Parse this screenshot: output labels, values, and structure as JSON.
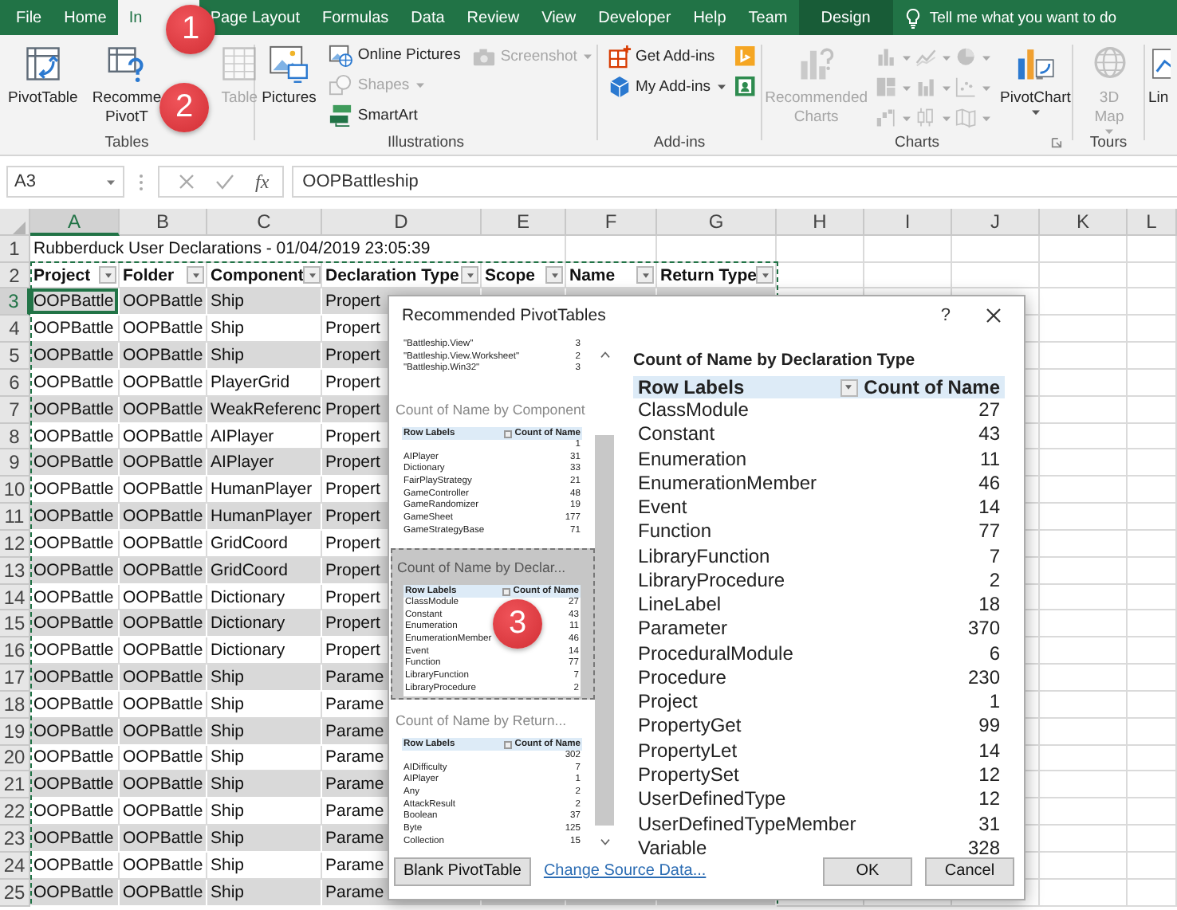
{
  "tabs": [
    {
      "label": "File",
      "selected": false,
      "contextual": false
    },
    {
      "label": "Home",
      "selected": false,
      "contextual": false
    },
    {
      "label": "In",
      "selected": true,
      "contextual": false
    },
    {
      "label": "Page Layout",
      "selected": false,
      "contextual": false
    },
    {
      "label": "Formulas",
      "selected": false,
      "contextual": false
    },
    {
      "label": "Data",
      "selected": false,
      "contextual": false
    },
    {
      "label": "Review",
      "selected": false,
      "contextual": false
    },
    {
      "label": "View",
      "selected": false,
      "contextual": false
    },
    {
      "label": "Developer",
      "selected": false,
      "contextual": false
    },
    {
      "label": "Help",
      "selected": false,
      "contextual": false
    },
    {
      "label": "Team",
      "selected": false,
      "contextual": false
    },
    {
      "label": "Design",
      "selected": false,
      "contextual": true
    }
  ],
  "tell_me": {
    "placeholder": "Tell me what you want to do"
  },
  "ribbon": {
    "groups": [
      {
        "label": "Tables",
        "columns": [
          [
            {
              "kind": "large",
              "lines": [
                "PivotTable"
              ],
              "disabled": false,
              "dropdown": false
            }
          ],
          [
            {
              "kind": "large",
              "lines": [
                "Recomme",
                "PivotT"
              ],
              "disabled": false,
              "dropdown": false
            }
          ],
          [
            {
              "kind": "large",
              "lines": [
                "Table"
              ],
              "disabled": true,
              "dropdown": false
            }
          ]
        ]
      },
      {
        "label": "Illustrations",
        "columns": [
          [
            {
              "kind": "large",
              "lines": [
                "Pictures"
              ],
              "disabled": false,
              "dropdown": false
            }
          ],
          [
            {
              "kind": "small",
              "label": "Online Pictures",
              "disabled": false,
              "dropdown": false
            },
            {
              "kind": "small",
              "label": "Shapes",
              "disabled": true,
              "dropdown": true
            },
            {
              "kind": "small",
              "label": "SmartArt",
              "disabled": false,
              "dropdown": false
            }
          ],
          [
            {
              "kind": "small",
              "label": "Screenshot",
              "disabled": true,
              "dropdown": true
            }
          ]
        ]
      },
      {
        "label": "Add-ins",
        "columns": [
          [
            {
              "kind": "small",
              "label": "Get Add-ins",
              "disabled": false,
              "dropdown": false
            },
            {
              "kind": "small",
              "label": "My Add-ins",
              "disabled": false,
              "dropdown": true
            }
          ],
          [
            {
              "kind": "icon",
              "disabled": false,
              "dropdown": false
            },
            {
              "kind": "icon",
              "disabled": false,
              "dropdown": false
            }
          ]
        ]
      },
      {
        "label": "Charts",
        "launcher": true,
        "columns": [
          [
            {
              "kind": "large",
              "lines": [
                "Recommended",
                "Charts"
              ],
              "disabled": true,
              "dropdown": false
            }
          ],
          [
            {
              "kind": "icon",
              "disabled": true,
              "dropdown": true
            },
            {
              "kind": "icon",
              "disabled": true,
              "dropdown": true
            },
            {
              "kind": "icon",
              "disabled": true,
              "dropdown": true
            }
          ],
          [
            {
              "kind": "icon",
              "disabled": true,
              "dropdown": true
            },
            {
              "kind": "icon",
              "disabled": true,
              "dropdown": true
            },
            {
              "kind": "icon",
              "disabled": true,
              "dropdown": true
            }
          ],
          [
            {
              "kind": "icon",
              "disabled": true,
              "dropdown": true
            },
            {
              "kind": "icon",
              "disabled": true,
              "dropdown": true
            },
            {
              "kind": "icon",
              "disabled": true,
              "dropdown": true
            }
          ],
          [
            {
              "kind": "large",
              "lines": [
                "PivotChart"
              ],
              "disabled": false,
              "dropdown": true
            }
          ]
        ]
      },
      {
        "label": "Tours",
        "columns": [
          [
            {
              "kind": "large",
              "lines": [
                "3D",
                "Map"
              ],
              "disabled": true,
              "dropdown": true
            }
          ]
        ]
      },
      {
        "columns": [
          [
            {
              "kind": "large",
              "lines": [
                "Lin"
              ],
              "disabled": false,
              "dropdown": false
            }
          ]
        ]
      }
    ]
  },
  "formula_bar": {
    "name_box": "A3",
    "function_label": "fx",
    "formula": "OOPBattleship"
  },
  "sheet": {
    "marquee": true,
    "columns": [
      {
        "label": "A",
        "selected": true
      },
      {
        "label": "B",
        "selected": false
      },
      {
        "label": "C",
        "selected": false
      },
      {
        "label": "D",
        "selected": false
      },
      {
        "label": "E",
        "selected": false
      },
      {
        "label": "F",
        "selected": false
      },
      {
        "label": "G",
        "selected": false
      },
      {
        "label": "H",
        "selected": false
      },
      {
        "label": "I",
        "selected": false
      },
      {
        "label": "J",
        "selected": false
      },
      {
        "label": "K",
        "selected": false
      },
      {
        "label": "L",
        "selected": false
      }
    ],
    "rows": [
      {
        "number": "1",
        "kind": "title",
        "selected": false,
        "banded": false,
        "cells": [
          "Rubberduck User Declarations - 01/04/2019 23:05:39"
        ]
      },
      {
        "number": "2",
        "kind": "header",
        "selected": false,
        "banded": false,
        "cells": [
          "Project",
          "Folder",
          "Component",
          "Declaration Type",
          "Scope",
          "Name",
          "Return Type"
        ]
      },
      {
        "number": "3",
        "kind": "data",
        "selected": true,
        "banded": true,
        "cells": [
          "OOPBattle",
          "OOPBattle",
          "Ship",
          "Propert"
        ]
      },
      {
        "number": "4",
        "kind": "data",
        "selected": false,
        "banded": false,
        "cells": [
          "OOPBattle",
          "OOPBattle",
          "Ship",
          "Propert"
        ]
      },
      {
        "number": "5",
        "kind": "data",
        "selected": false,
        "banded": true,
        "cells": [
          "OOPBattle",
          "OOPBattle",
          "Ship",
          "Propert"
        ]
      },
      {
        "number": "6",
        "kind": "data",
        "selected": false,
        "banded": false,
        "cells": [
          "OOPBattle",
          "OOPBattle",
          "PlayerGrid",
          "Propert"
        ]
      },
      {
        "number": "7",
        "kind": "data",
        "selected": false,
        "banded": true,
        "cells": [
          "OOPBattle",
          "OOPBattle",
          "WeakReferenc",
          "Propert"
        ]
      },
      {
        "number": "8",
        "kind": "data",
        "selected": false,
        "banded": false,
        "cells": [
          "OOPBattle",
          "OOPBattle",
          "AIPlayer",
          "Propert"
        ]
      },
      {
        "number": "9",
        "kind": "data",
        "selected": false,
        "banded": true,
        "cells": [
          "OOPBattle",
          "OOPBattle",
          "AIPlayer",
          "Propert"
        ]
      },
      {
        "number": "10",
        "kind": "data",
        "selected": false,
        "banded": false,
        "cells": [
          "OOPBattle",
          "OOPBattle",
          "HumanPlayer",
          "Propert"
        ]
      },
      {
        "number": "11",
        "kind": "data",
        "selected": false,
        "banded": true,
        "cells": [
          "OOPBattle",
          "OOPBattle",
          "HumanPlayer",
          "Propert"
        ]
      },
      {
        "number": "12",
        "kind": "data",
        "selected": false,
        "banded": false,
        "cells": [
          "OOPBattle",
          "OOPBattle",
          "GridCoord",
          "Propert"
        ]
      },
      {
        "number": "13",
        "kind": "data",
        "selected": false,
        "banded": true,
        "cells": [
          "OOPBattle",
          "OOPBattle",
          "GridCoord",
          "Propert"
        ]
      },
      {
        "number": "14",
        "kind": "data",
        "selected": false,
        "banded": false,
        "cells": [
          "OOPBattle",
          "OOPBattle",
          "Dictionary",
          "Propert"
        ]
      },
      {
        "number": "15",
        "kind": "data",
        "selected": false,
        "banded": true,
        "cells": [
          "OOPBattle",
          "OOPBattle",
          "Dictionary",
          "Propert"
        ]
      },
      {
        "number": "16",
        "kind": "data",
        "selected": false,
        "banded": false,
        "cells": [
          "OOPBattle",
          "OOPBattle",
          "Dictionary",
          "Propert"
        ]
      },
      {
        "number": "17",
        "kind": "data",
        "selected": false,
        "banded": true,
        "cells": [
          "OOPBattle",
          "OOPBattle",
          "Ship",
          "Parame"
        ]
      },
      {
        "number": "18",
        "kind": "data",
        "selected": false,
        "banded": false,
        "cells": [
          "OOPBattle",
          "OOPBattle",
          "Ship",
          "Parame"
        ]
      },
      {
        "number": "19",
        "kind": "data",
        "selected": false,
        "banded": true,
        "cells": [
          "OOPBattle",
          "OOPBattle",
          "Ship",
          "Parame"
        ]
      },
      {
        "number": "20",
        "kind": "data",
        "selected": false,
        "banded": false,
        "cells": [
          "OOPBattle",
          "OOPBattle",
          "Ship",
          "Parame"
        ]
      },
      {
        "number": "21",
        "kind": "data",
        "selected": false,
        "banded": true,
        "cells": [
          "OOPBattle",
          "OOPBattle",
          "Ship",
          "Parame"
        ]
      },
      {
        "number": "22",
        "kind": "data",
        "selected": false,
        "banded": false,
        "cells": [
          "OOPBattle",
          "OOPBattle",
          "Ship",
          "Parame"
        ]
      },
      {
        "number": "23",
        "kind": "data",
        "selected": false,
        "banded": true,
        "cells": [
          "OOPBattle",
          "OOPBattle",
          "Ship",
          "Parame"
        ]
      },
      {
        "number": "24",
        "kind": "data",
        "selected": false,
        "banded": false,
        "cells": [
          "OOPBattle",
          "OOPBattle",
          "Ship",
          "Parame"
        ]
      },
      {
        "number": "25",
        "kind": "data",
        "selected": false,
        "banded": true,
        "cells": [
          "OOPBattle",
          "OOPBattle",
          "Ship",
          "Parame"
        ]
      }
    ]
  },
  "dialog": {
    "title": "Recommended PivotTables",
    "help_label": "?",
    "cards": [
      {
        "selected": false,
        "rows": [
          {
            "label": "\"Battleship.View\"",
            "count": "3"
          },
          {
            "label": "\"Battleship.View.Worksheet\"",
            "count": "2"
          },
          {
            "label": "\"Battleship.Win32\"",
            "count": "3"
          }
        ]
      },
      {
        "title": "Count of Name by Component",
        "selected": false,
        "columns": [
          "Row Labels",
          "Count of Name"
        ],
        "rows": [
          {
            "count": "1"
          },
          {
            "label": "AIPlayer",
            "count": "31"
          },
          {
            "label": "Dictionary",
            "count": "33"
          },
          {
            "label": "FairPlayStrategy",
            "count": "21"
          },
          {
            "label": "GameController",
            "count": "48"
          },
          {
            "label": "GameRandomizer",
            "count": "19"
          },
          {
            "label": "GameSheet",
            "count": "177"
          },
          {
            "label": "GameStrategyBase",
            "count": "71"
          }
        ]
      },
      {
        "title": "Count of Name by Declar...",
        "selected": true,
        "columns": [
          "Row Labels",
          "Count of Name"
        ],
        "rows": [
          {
            "label": "ClassModule",
            "count": "27"
          },
          {
            "label": "Constant",
            "count": "43"
          },
          {
            "label": "Enumeration",
            "count": "11"
          },
          {
            "label": "EnumerationMember",
            "count": "46"
          },
          {
            "label": "Event",
            "count": "14"
          },
          {
            "label": "Function",
            "count": "77"
          },
          {
            "label": "LibraryFunction",
            "count": "7"
          },
          {
            "label": "LibraryProcedure",
            "count": "2"
          }
        ]
      },
      {
        "title": "Count of Name by Return...",
        "selected": false,
        "columns": [
          "Row Labels",
          "Count of Name"
        ],
        "rows": [
          {
            "count": "302"
          },
          {
            "label": "AIDifficulty",
            "count": "7"
          },
          {
            "label": "AIPlayer",
            "count": "1"
          },
          {
            "label": "Any",
            "count": "2"
          },
          {
            "label": "AttackResult",
            "count": "2"
          },
          {
            "label": "Boolean",
            "count": "37"
          },
          {
            "label": "Byte",
            "count": "125"
          },
          {
            "label": "Collection",
            "count": "15"
          }
        ]
      }
    ],
    "preview": {
      "title": "Count of Name by Declaration Type",
      "columns": [
        "Row Labels",
        "Count of Name"
      ],
      "rows": [
        {
          "label": "ClassModule",
          "count": "27"
        },
        {
          "label": "Constant",
          "count": "43"
        },
        {
          "label": "Enumeration",
          "count": "11"
        },
        {
          "label": "EnumerationMember",
          "count": "46"
        },
        {
          "label": "Event",
          "count": "14"
        },
        {
          "label": "Function",
          "count": "77"
        },
        {
          "label": "LibraryFunction",
          "count": "7"
        },
        {
          "label": "LibraryProcedure",
          "count": "2"
        },
        {
          "label": "LineLabel",
          "count": "18"
        },
        {
          "label": "Parameter",
          "count": "370"
        },
        {
          "label": "ProceduralModule",
          "count": "6"
        },
        {
          "label": "Procedure",
          "count": "230"
        },
        {
          "label": "Project",
          "count": "1"
        },
        {
          "label": "PropertyGet",
          "count": "99"
        },
        {
          "label": "PropertyLet",
          "count": "14"
        },
        {
          "label": "PropertySet",
          "count": "12"
        },
        {
          "label": "UserDefinedType",
          "count": "12"
        },
        {
          "label": "UserDefinedTypeMember",
          "count": "31"
        },
        {
          "label": "Variable",
          "count": "328"
        }
      ]
    },
    "buttons": [
      {
        "label": "Blank PivotTable",
        "kind": "button"
      },
      {
        "label": "Change Source Data...",
        "kind": "link"
      },
      {
        "label": "OK",
        "kind": "button"
      },
      {
        "label": "Cancel",
        "kind": "button"
      }
    ]
  },
  "annotations": [
    {
      "label": "1"
    },
    {
      "label": "2"
    },
    {
      "label": "3"
    }
  ]
}
